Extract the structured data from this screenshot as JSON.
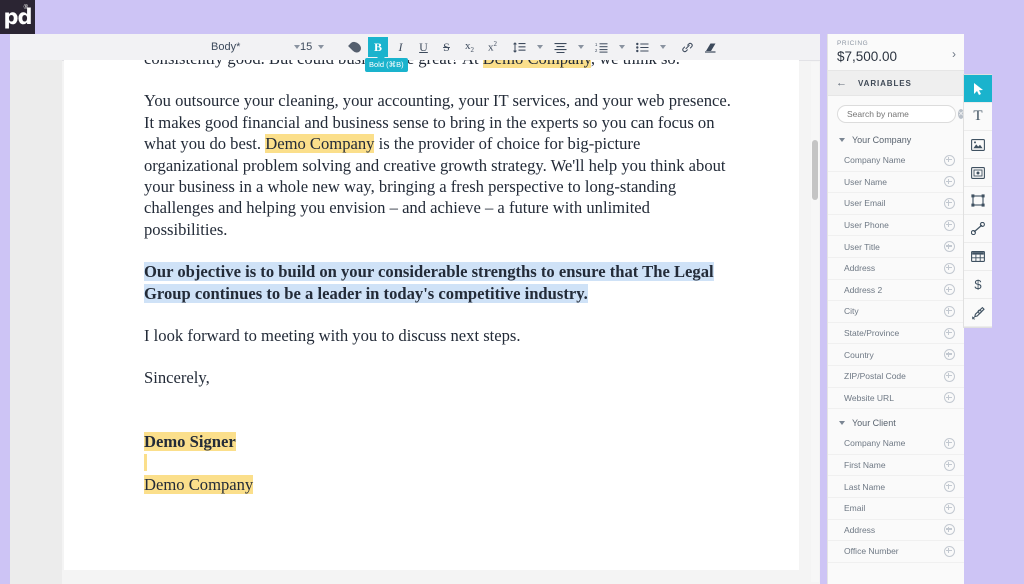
{
  "app": {
    "logo_text": "pd",
    "logo_registered": "®"
  },
  "toolbar": {
    "style_value": "Body*",
    "style_caret": "▾",
    "size_value": "15",
    "size_caret": "▾",
    "items": [
      {
        "name": "text-color-icon",
        "label": "Text color"
      },
      {
        "name": "bold-button",
        "label": "B",
        "active": true
      },
      {
        "name": "italic-button",
        "label": "I"
      },
      {
        "name": "underline-button",
        "label": "U"
      },
      {
        "name": "strikethrough-button",
        "label": "S"
      },
      {
        "name": "subscript-button",
        "label": "x₂"
      },
      {
        "name": "superscript-button",
        "label": "x²"
      },
      {
        "name": "line-spacing-button",
        "label": "Line spacing"
      },
      {
        "name": "align-button",
        "label": "Align"
      },
      {
        "name": "numbered-list-button",
        "label": "Numbered list"
      },
      {
        "name": "bulleted-list-button",
        "label": "Bulleted list"
      },
      {
        "name": "link-button",
        "label": "Link"
      },
      {
        "name": "clear-formatting-button",
        "label": "Clear formatting"
      }
    ],
    "tooltip": "Bold (⌘B)"
  },
  "document": {
    "paragraphs": [
      {
        "id": "p1",
        "runs": [
          {
            "text": "consistently good. But could business be great? At ",
            "style": "plain"
          },
          {
            "text": "Demo Company",
            "style": "highlight-yellow"
          },
          {
            "text": ", we think so.",
            "style": "plain"
          }
        ]
      },
      {
        "id": "p2",
        "runs": [
          {
            "text": "You outsource your cleaning, your accounting, your IT services, and your web presence. It makes good financial and business sense to bring in the experts so you can focus on what you do best. ",
            "style": "plain"
          },
          {
            "text": "Demo Company",
            "style": "highlight-yellow"
          },
          {
            "text": " is the provider of choice for big-picture organizational problem solving and creative growth strategy. We'll help you think about your business in a whole new way, bringing a fresh perspective to long-standing challenges and helping you envision – and achieve – a future with unlimited possibilities.",
            "style": "plain"
          }
        ]
      },
      {
        "id": "p3",
        "runs": [
          {
            "text": "Our objective is to build on your considerable strengths to ensure that The Legal Group continues to be a leader in today's competitive industry.",
            "style": "bold-selected"
          }
        ]
      },
      {
        "id": "p4",
        "runs": [
          {
            "text": "I look forward to meeting with you to discuss next steps.",
            "style": "plain"
          }
        ]
      },
      {
        "id": "p5",
        "runs": [
          {
            "text": "Sincerely,",
            "style": "plain"
          }
        ]
      },
      {
        "id": "p6",
        "runs": [
          {
            "text": "Demo Signer",
            "style": "bold-highlight-yellow"
          }
        ]
      },
      {
        "id": "p7",
        "runs": [
          {
            "text": "Demo Company",
            "style": "highlight-yellow"
          }
        ]
      }
    ]
  },
  "right_panel": {
    "pricing": {
      "label": "PRICING",
      "value": "$7,500.00",
      "chevron": "›"
    },
    "variables": {
      "back_arrow": "←",
      "title": "VARIABLES",
      "search_placeholder": "Search by name",
      "search_value": "",
      "clear_glyph": "✕",
      "groups": [
        {
          "name": "Your Company",
          "expanded": true,
          "items": [
            "Company Name",
            "User Name",
            "User Email",
            "User Phone",
            "User Title",
            "Address",
            "Address 2",
            "City",
            "State/Province",
            "Country",
            "ZIP/Postal Code",
            "Website URL"
          ]
        },
        {
          "name": "Your Client",
          "expanded": true,
          "items": [
            "Company Name",
            "First Name",
            "Last Name",
            "Email",
            "Address",
            "Office Number"
          ]
        }
      ]
    }
  },
  "tool_rail": {
    "tools": [
      {
        "name": "select-tool",
        "label": "Select",
        "active": true
      },
      {
        "name": "text-tool",
        "label": "Text",
        "active": false
      },
      {
        "name": "image-tool",
        "label": "Image",
        "active": false
      },
      {
        "name": "video-tool",
        "label": "Video",
        "active": false
      },
      {
        "name": "shape-tool",
        "label": "Shape",
        "active": false
      },
      {
        "name": "line-tool",
        "label": "Line",
        "active": false
      },
      {
        "name": "table-tool",
        "label": "Table",
        "active": false
      },
      {
        "name": "pricing-tool",
        "label": "$",
        "active": false
      },
      {
        "name": "signature-tool",
        "label": "Signature",
        "active": false
      }
    ]
  },
  "colors": {
    "accent": "#1ab3cd",
    "highlight_yellow": "#fbdf8b",
    "selection_blue": "#cfe2f7",
    "page_bg": "#cdc4f5",
    "logo_bg": "#2b2533"
  }
}
